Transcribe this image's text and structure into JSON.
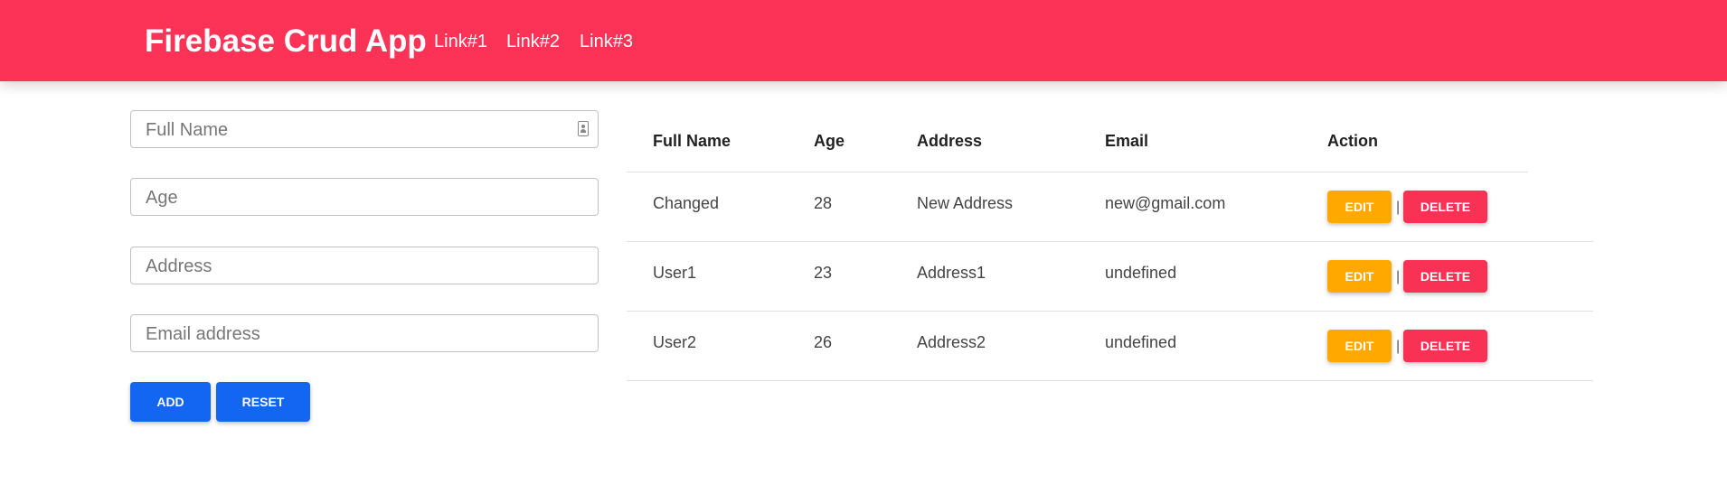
{
  "navbar": {
    "brand": "Firebase Crud App",
    "links": [
      "Link#1",
      "Link#2",
      "Link#3"
    ]
  },
  "form": {
    "full_name": {
      "placeholder": "Full Name",
      "value": ""
    },
    "age": {
      "placeholder": "Age",
      "value": ""
    },
    "address": {
      "placeholder": "Address",
      "value": ""
    },
    "email": {
      "placeholder": "Email address",
      "value": ""
    },
    "add_label": "ADD",
    "reset_label": "RESET"
  },
  "colors": {
    "navbar": "#fd3257",
    "primary": "#1266f1",
    "warning": "#ffa900",
    "danger": "#f93154"
  },
  "table": {
    "headers": [
      "Full Name",
      "Age",
      "Address",
      "Email",
      "Action"
    ],
    "rows": [
      {
        "full_name": "Changed",
        "age": "28",
        "address": "New Address",
        "email": "new@gmail.com"
      },
      {
        "full_name": "User1",
        "age": "23",
        "address": "Address1",
        "email": "undefined"
      },
      {
        "full_name": "User2",
        "age": "26",
        "address": "Address2",
        "email": "undefined"
      }
    ],
    "edit_label": "EDIT",
    "delete_label": "DELETE",
    "separator": "|"
  }
}
